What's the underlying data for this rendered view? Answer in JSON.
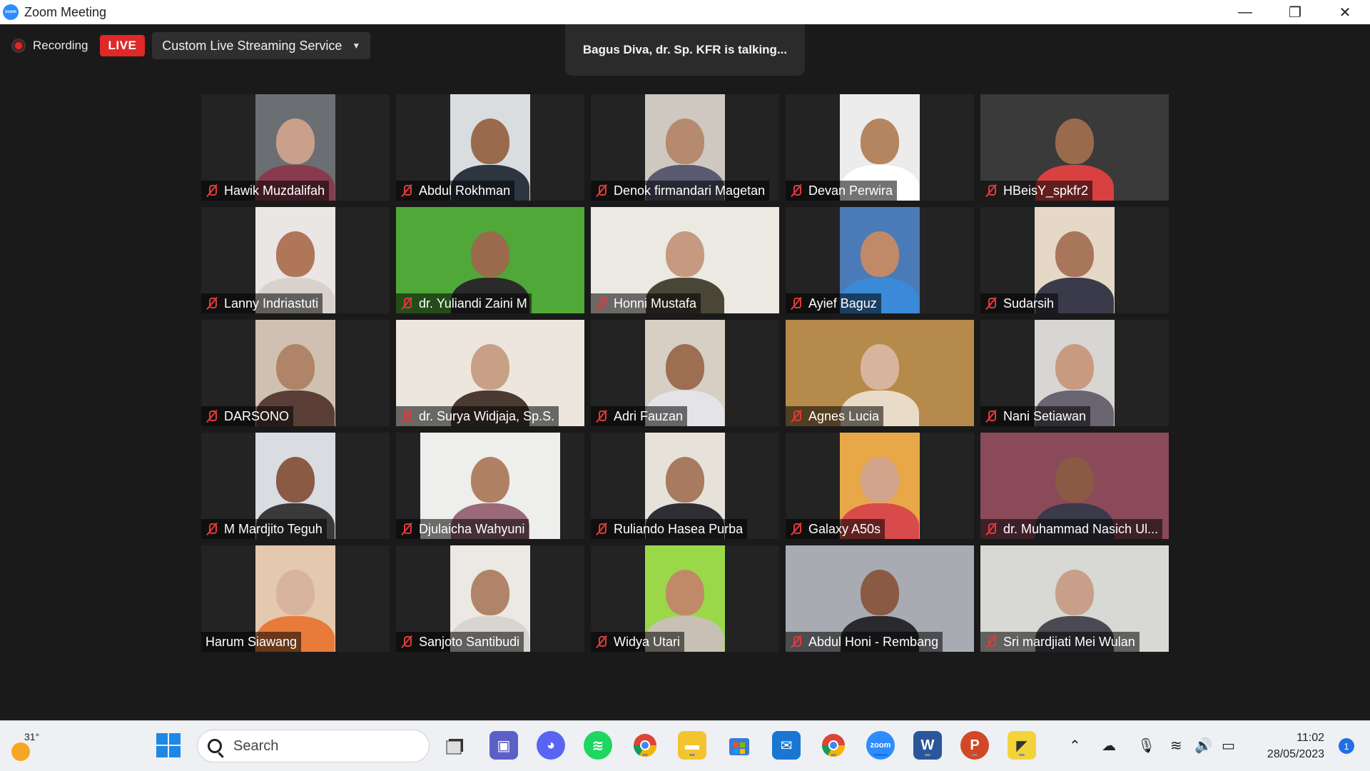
{
  "window": {
    "title": "Zoom Meeting",
    "minimize_glyph": "—",
    "restore_glyph": "❐",
    "close_glyph": "✕"
  },
  "recording": {
    "label": "Recording",
    "live_badge": "LIVE",
    "stream_service": "Custom Live Streaming Service"
  },
  "talking": "Bagus Diva, dr. Sp. KFR is talking...",
  "participants": [
    {
      "name": "Hawik Muzdalifah",
      "muted": true,
      "bg": "#6b6e73",
      "skin": "#c9a08a",
      "cloth": "#8a3a4e"
    },
    {
      "name": "Abdul Rokhman",
      "muted": true,
      "bg": "#d9dde0",
      "skin": "#9a6a4c",
      "cloth": "#2d3540"
    },
    {
      "name": "Denok firmandari Magetan",
      "muted": true,
      "bg": "#cfc8c0",
      "skin": "#b58a6e",
      "cloth": "#5a5a70"
    },
    {
      "name": "Devan Perwira",
      "muted": true,
      "bg": "#ececec",
      "skin": "#b5855f",
      "cloth": "#ffffff"
    },
    {
      "name": "HBeisY_spkfr2",
      "muted": true,
      "bg": "#3a3a3a",
      "skin": "#9a6a4c",
      "cloth": "#d94040"
    },
    {
      "name": "Lanny Indriastuti",
      "muted": true,
      "bg": "#e9e6e3",
      "skin": "#b0765a",
      "cloth": "#d9d2cc"
    },
    {
      "name": "dr. Yuliandi Zaini M",
      "muted": true,
      "bg": "#4fa838",
      "skin": "#9a6a4c",
      "cloth": "#2a2a2a"
    },
    {
      "name": "Honni Mustafa",
      "muted": true,
      "bg": "#ece8e2",
      "skin": "#c59a80",
      "cloth": "#4a4636"
    },
    {
      "name": "Ayief Baguz",
      "muted": true,
      "bg": "#4a7bb8",
      "skin": "#c08a68",
      "cloth": "#3b8ad8"
    },
    {
      "name": "Sudarsih",
      "muted": true,
      "bg": "#e6d8c6",
      "skin": "#a8765a",
      "cloth": "#3a3a4a"
    },
    {
      "name": "DARSONO",
      "muted": true,
      "bg": "#cfc0b2",
      "skin": "#b08468",
      "cloth": "#5a3e36"
    },
    {
      "name": "dr. Surya Widjaja, Sp.S.",
      "muted": true,
      "bg": "#ece6de",
      "skin": "#c8a086",
      "cloth": "#4a3a32"
    },
    {
      "name": "Adri Fauzan",
      "muted": true,
      "bg": "#d7cfc3",
      "skin": "#9c6e52",
      "cloth": "#e4e4e8"
    },
    {
      "name": "Agnes Lucia",
      "muted": true,
      "bg": "#b68a4a",
      "skin": "#d8b49c",
      "cloth": "#e8dcc8"
    },
    {
      "name": "Nani Setiawan",
      "muted": true,
      "bg": "#d8d6d2",
      "skin": "#c89a80",
      "cloth": "#6a6470"
    },
    {
      "name": "M Mardjito Teguh",
      "muted": true,
      "bg": "#d9dce0",
      "skin": "#8a5a44",
      "cloth": "#3a3a3a"
    },
    {
      "name": "Djulaicha Wahyuni",
      "muted": true,
      "bg": "#eeeeec",
      "skin": "#b08064",
      "cloth": "#9a6a78"
    },
    {
      "name": "Ruliando Hasea Purba",
      "muted": true,
      "bg": "#e6e2da",
      "skin": "#a87a60",
      "cloth": "#2e2e34"
    },
    {
      "name": "Galaxy A50s",
      "muted": true,
      "bg": "#e8a848",
      "skin": "#d2a48c",
      "cloth": "#d94a4a"
    },
    {
      "name": "dr. Muhammad Nasich Ul...",
      "muted": true,
      "bg": "#8a4a5a",
      "skin": "#8a5a44",
      "cloth": "#3a3a4a"
    },
    {
      "name": "Harum Siawang",
      "muted": false,
      "bg": "#e4c8b0",
      "skin": "#d8b49c",
      "cloth": "#e87a3a"
    },
    {
      "name": "Sanjoto Santibudi",
      "muted": true,
      "bg": "#ece8e4",
      "skin": "#b08468",
      "cloth": "#d8d4d0"
    },
    {
      "name": "Widya Utari",
      "muted": true,
      "bg": "#9ad84a",
      "skin": "#c08a68",
      "cloth": "#c8c0b4"
    },
    {
      "name": "Abdul Honi - Rembang",
      "muted": true,
      "bg": "#a8acb2",
      "skin": "#8a5a44",
      "cloth": "#2a2a2e"
    },
    {
      "name": "Sri mardjiati Mei Wulan",
      "muted": true,
      "bg": "#d8d8d4",
      "skin": "#c8a08a",
      "cloth": "#4a4a52"
    }
  ],
  "taskbar": {
    "weather_temp": "31°",
    "search_placeholder": "Search",
    "clock_time": "11:02",
    "clock_date": "28/05/2023",
    "notification_count": "1"
  }
}
